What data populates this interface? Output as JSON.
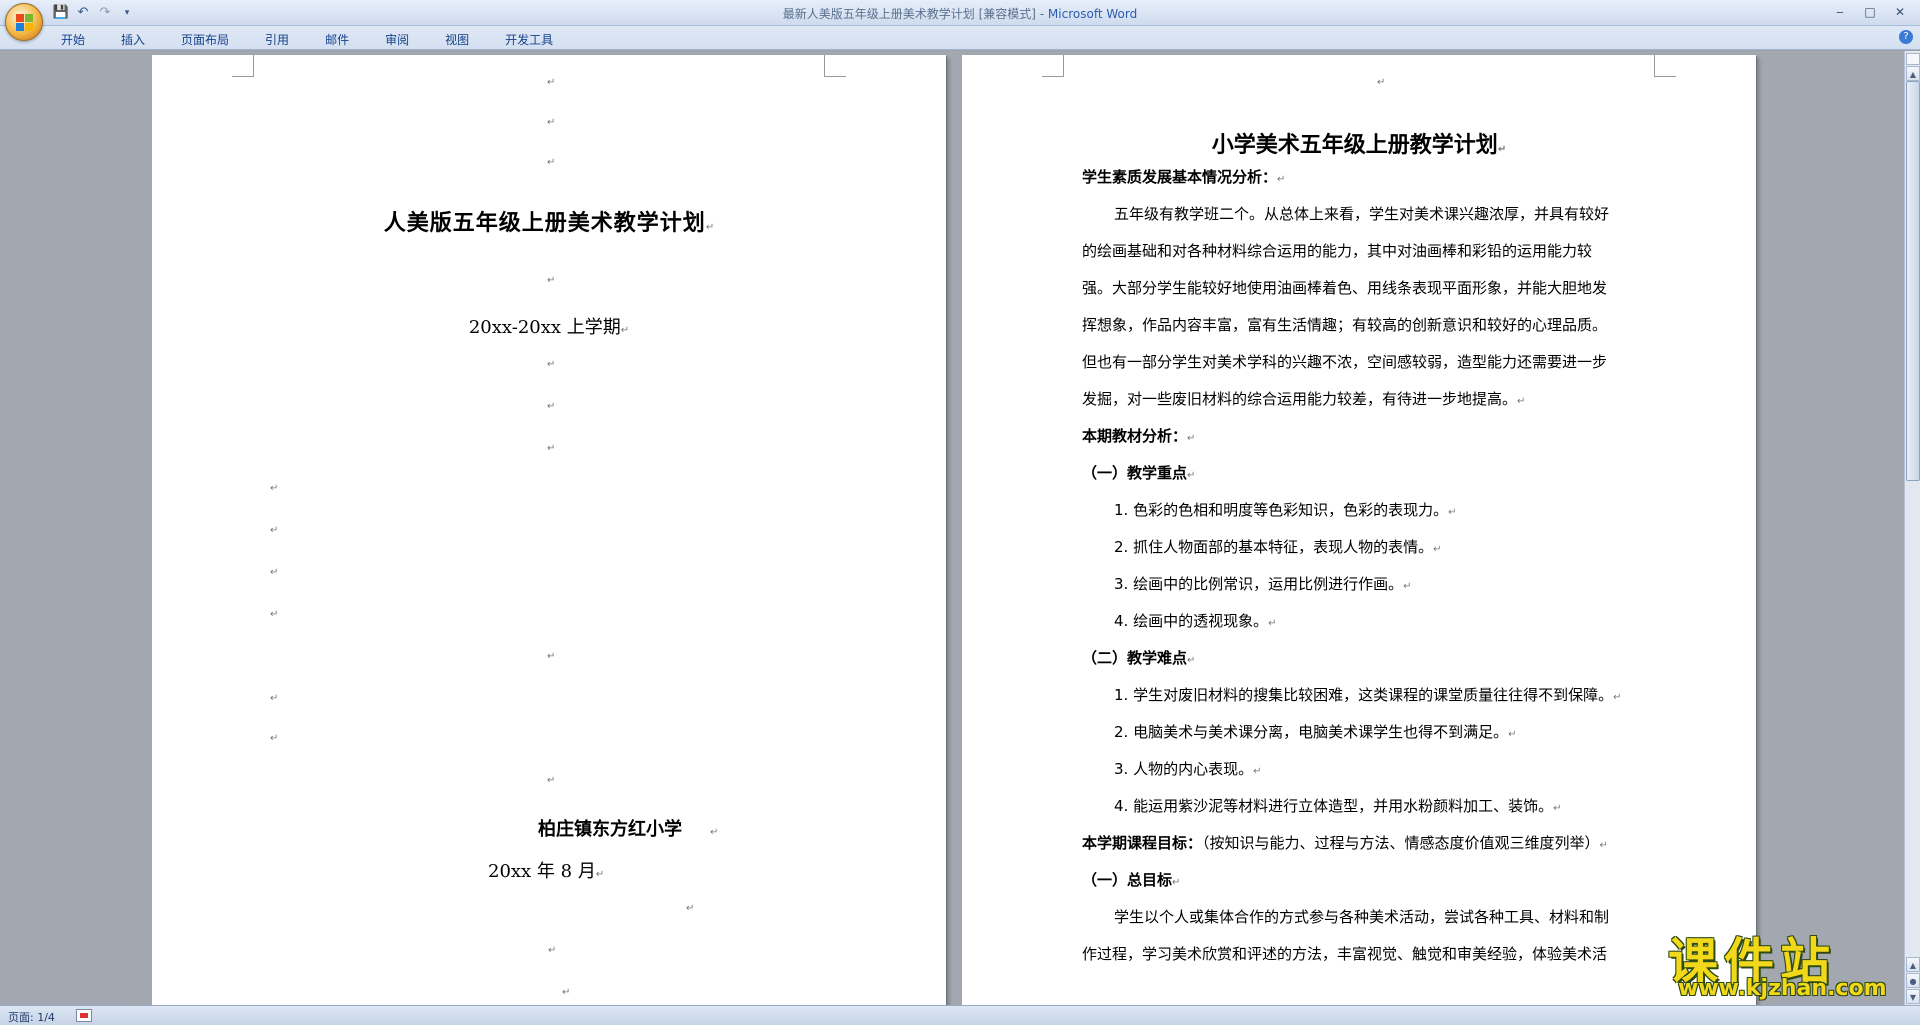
{
  "window": {
    "title": "最新人美版五年级上册美术教学计划 [兼容模式] - ",
    "app_name": "Microsoft Word"
  },
  "quick_access": [
    "save-icon",
    "undo-icon",
    "redo-icon",
    "customize-dropdown-icon"
  ],
  "ribbon": {
    "tabs": [
      "开始",
      "插入",
      "页面布局",
      "引用",
      "邮件",
      "审阅",
      "视图",
      "开发工具"
    ]
  },
  "page1": {
    "title": "人美版五年级上册美术教学计划",
    "term": "20xx-20xx 上学期",
    "school": "柏庄镇东方红小学",
    "date": "20xx 年 8 月"
  },
  "page2": {
    "title": "小学美术五年级上册教学计划",
    "section1_heading": "学生素质发展基本情况分析：",
    "section1_lines": [
      "五年级有教学班二个。从总体上来看，学生对美术课兴趣浓厚，并具有较好",
      "的绘画基础和对各种材料综合运用的能力，其中对油画棒和彩铅的运用能力较",
      "强。大部分学生能较好地使用油画棒着色、用线条表现平面形象，并能大胆地发",
      "挥想象，作品内容丰富，富有生活情趣；有较高的创新意识和较好的心理品质。",
      "但也有一部分学生对美术学科的兴趣不浓，空间感较弱，造型能力还需要进一步",
      "发掘，对一些废旧材料的综合运用能力较差，有待进一步地提高。"
    ],
    "section2_heading": "本期教材分析：",
    "key_points_heading": "（一）教学重点",
    "key_points": [
      "1.  色彩的色相和明度等色彩知识，色彩的表现力。",
      "2.  抓住人物面部的基本特征，表现人物的表情。",
      "3.  绘画中的比例常识，运用比例进行作画。",
      "4.  绘画中的透视现象。"
    ],
    "difficulties_heading": "（二）教学难点",
    "difficulties": [
      "1. 学生对废旧材料的搜集比较困难，这类课程的课堂质量往往得不到保障。",
      "2.  电脑美术与美术课分离，电脑美术课学生也得不到满足。",
      "3.  人物的内心表现。",
      "4.  能运用紫沙泥等材料进行立体造型，并用水粉颜料加工、装饰。"
    ],
    "goals_heading": "本学期课程目标：",
    "goals_note": "（按知识与能力、过程与方法、情感态度价值观三维度列举）",
    "overall_goal_heading": "（一）总目标",
    "overall_goal_lines": [
      "学生以个人或集体合作的方式参与各种美术活动，尝试各种工具、材料和制",
      "作过程，学习美术欣赏和评述的方法，丰富视觉、触觉和审美经验，体验美术活"
    ]
  },
  "status": {
    "page": "页面: 1/4"
  },
  "watermark": {
    "main": "课件站",
    "url": "www.kjzhan.com"
  }
}
